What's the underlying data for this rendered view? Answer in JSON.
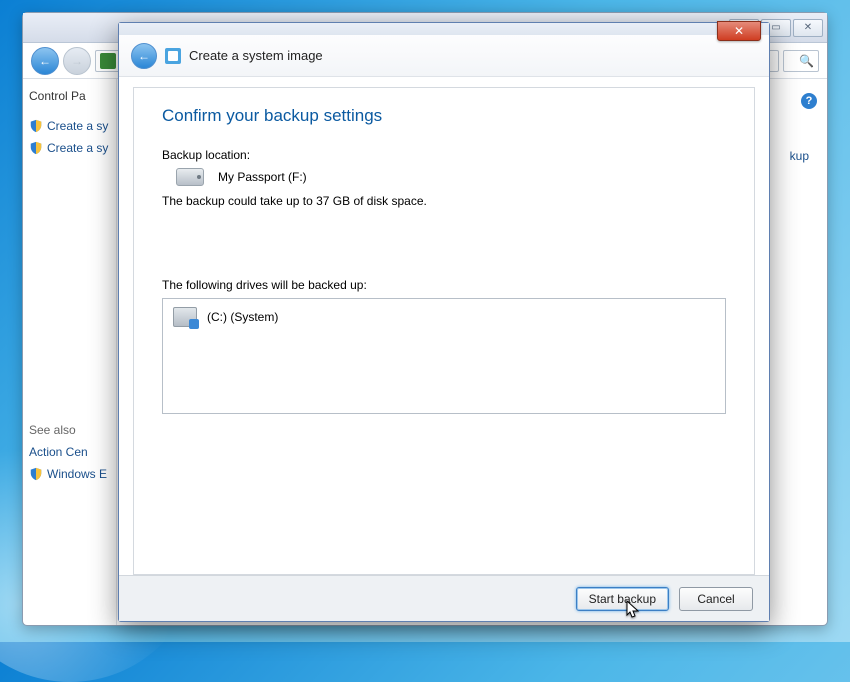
{
  "bg_window": {
    "sidebar_title": "Control Pa",
    "items": [
      "Create a sy",
      "Create a sy"
    ],
    "see_also": "See also",
    "see_items": [
      "Action Cen",
      "Windows E"
    ],
    "main_link": "kup"
  },
  "dialog": {
    "title": "Create a system image",
    "heading": "Confirm your backup settings",
    "backup_location_label": "Backup location:",
    "dest_name": "My Passport (F:)",
    "size_note": "The backup could take up to 37 GB of disk space.",
    "drives_label": "The following drives will be backed up:",
    "drives": [
      "(C:) (System)"
    ],
    "start_btn": "Start backup",
    "cancel_btn": "Cancel"
  }
}
